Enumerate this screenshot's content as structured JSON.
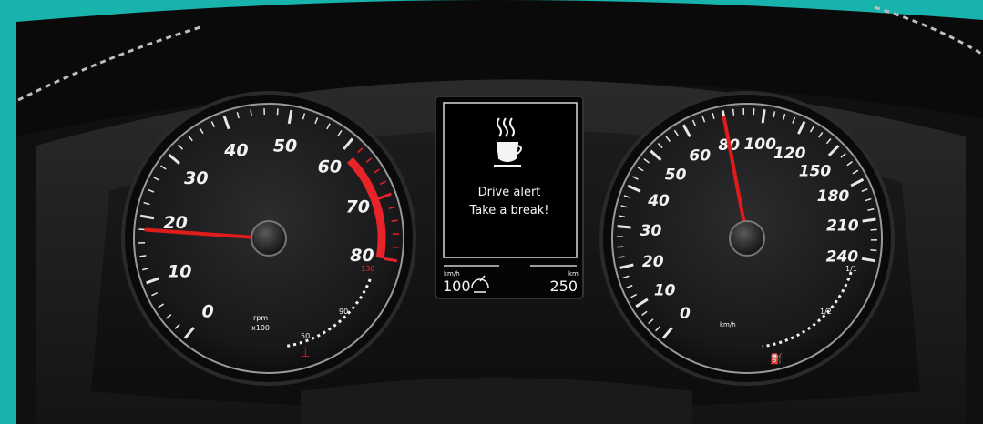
{
  "tachometer": {
    "numbers": [
      "0",
      "10",
      "20",
      "30",
      "40",
      "50",
      "60",
      "70",
      "80"
    ],
    "unit_line1": "rpm",
    "unit_line2": "x100",
    "needle_value": 18,
    "redline_start": 62,
    "temperature_gauge": {
      "labels": [
        "50",
        "90",
        "130"
      ],
      "level": 0.2
    }
  },
  "speedometer": {
    "numbers": [
      "0",
      "10",
      "20",
      "30",
      "40",
      "50",
      "60",
      "80",
      "100",
      "120",
      "150",
      "180",
      "210",
      "240"
    ],
    "unit": "km/h",
    "needle_value": 80,
    "fuel_gauge": {
      "labels": [
        "1/1",
        "1/2"
      ],
      "level": 0.2
    }
  },
  "display": {
    "icon": "coffee-cup-icon",
    "title": "Drive alert",
    "message": "Take a break!",
    "left_unit": "km/h",
    "left_value": "100",
    "right_unit": "km",
    "right_value": "250"
  },
  "colors": {
    "background": "#19b3ad",
    "needle": "#e01b1b",
    "redline": "#e8232a"
  }
}
